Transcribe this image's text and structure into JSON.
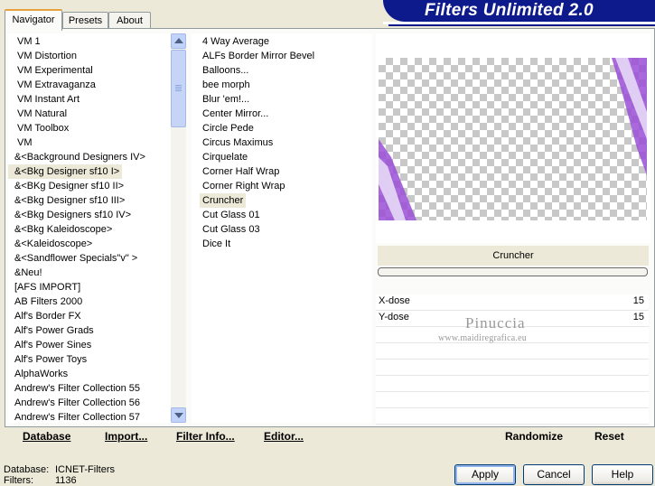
{
  "header": {
    "title": "Filters Unlimited 2.0"
  },
  "tabs": [
    {
      "label": "Navigator"
    },
    {
      "label": "Presets"
    },
    {
      "label": "About"
    }
  ],
  "categories": [
    "VM 1",
    "VM Distortion",
    "VM Experimental",
    "VM Extravaganza",
    "VM Instant Art",
    "VM Natural",
    "VM Toolbox",
    "VM",
    "&<Background Designers IV>",
    "&<Bkg Designer sf10 I>",
    "&<BKg Designer sf10 II>",
    "&<Bkg Designer sf10 III>",
    "&<Bkg Designers sf10 IV>",
    "&<Bkg Kaleidoscope>",
    "&<Kaleidoscope>",
    "&<Sandflower Specials\"v\" >",
    "&Neu!",
    "[AFS IMPORT]",
    "AB Filters 2000",
    "Alf's Border FX",
    "Alf's Power Grads",
    "Alf's Power Sines",
    "Alf's Power Toys",
    "AlphaWorks",
    "Andrew's Filter Collection 55",
    "Andrew's Filter Collection 56",
    "Andrew's Filter Collection 57"
  ],
  "selected_category": "&<Bkg Designer sf10 I>",
  "filters": [
    "4 Way Average",
    "ALFs Border Mirror Bevel",
    "Balloons...",
    "bee morph",
    "Blur 'em!...",
    "Center Mirror...",
    "Circle Pede",
    "Circus Maximus",
    "Cirquelate",
    "Corner Half Wrap",
    "Corner Right Wrap",
    "Cruncher",
    "Cut Glass 01",
    "Cut Glass 03",
    "Dice It"
  ],
  "selected_filter": "Cruncher",
  "preview": {
    "filter_name": "Cruncher",
    "progress": 0
  },
  "params": [
    {
      "label": "X-dose",
      "value": "15"
    },
    {
      "label": "Y-dose",
      "value": "15"
    }
  ],
  "watermark": {
    "name": "Pinuccia",
    "url": "www.maidiregrafica.eu"
  },
  "toolbar": {
    "database": "Database",
    "import": "Import...",
    "filter_info": "Filter Info...",
    "editor": "Editor...",
    "randomize": "Randomize",
    "reset": "Reset"
  },
  "status": {
    "database_label": "Database:",
    "database_value": "ICNET-Filters",
    "filters_label": "Filters:",
    "filters_value": "1136"
  },
  "buttons": {
    "apply": "Apply",
    "cancel": "Cancel",
    "help": "Help"
  },
  "colors": {
    "header_bg": "#0d1a8c",
    "preview_purple": "#9a4fd6",
    "selection_bg": "#ece9d8"
  }
}
